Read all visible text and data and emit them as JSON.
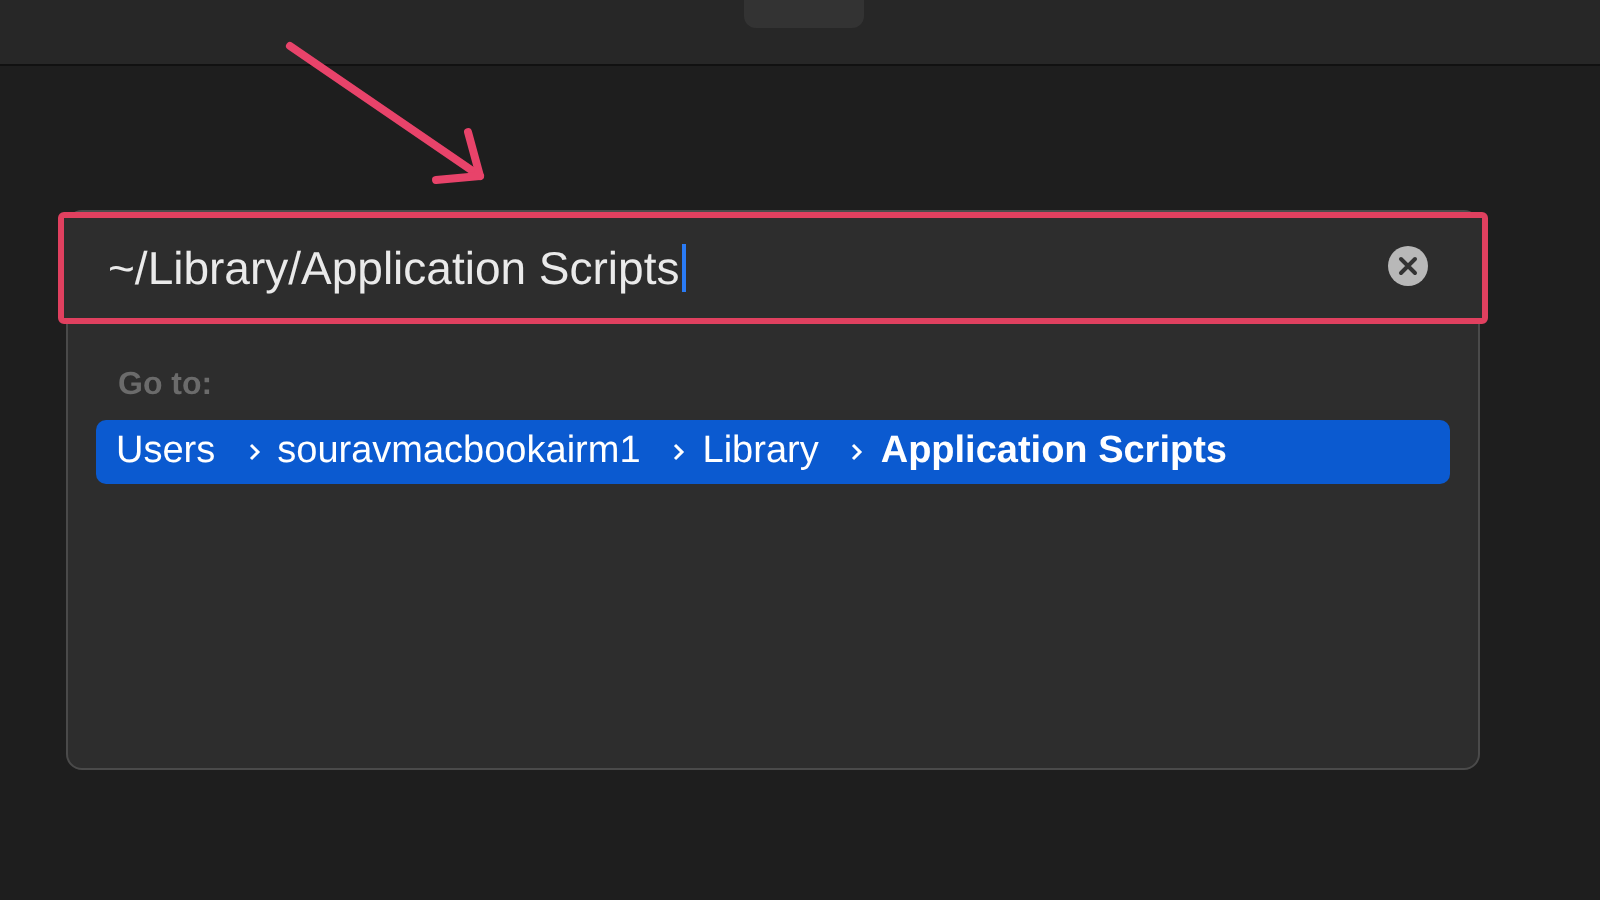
{
  "dialog": {
    "field": {
      "value": "~/Library/Application Scripts"
    },
    "section_label": "Go to:",
    "suggestions": [
      {
        "selected": true,
        "segments": [
          {
            "text": "Users",
            "current": false
          },
          {
            "text": "souravmacbookairm1",
            "current": false
          },
          {
            "text": "Library",
            "current": false
          },
          {
            "text": "Application Scripts",
            "current": true
          }
        ]
      }
    ]
  }
}
